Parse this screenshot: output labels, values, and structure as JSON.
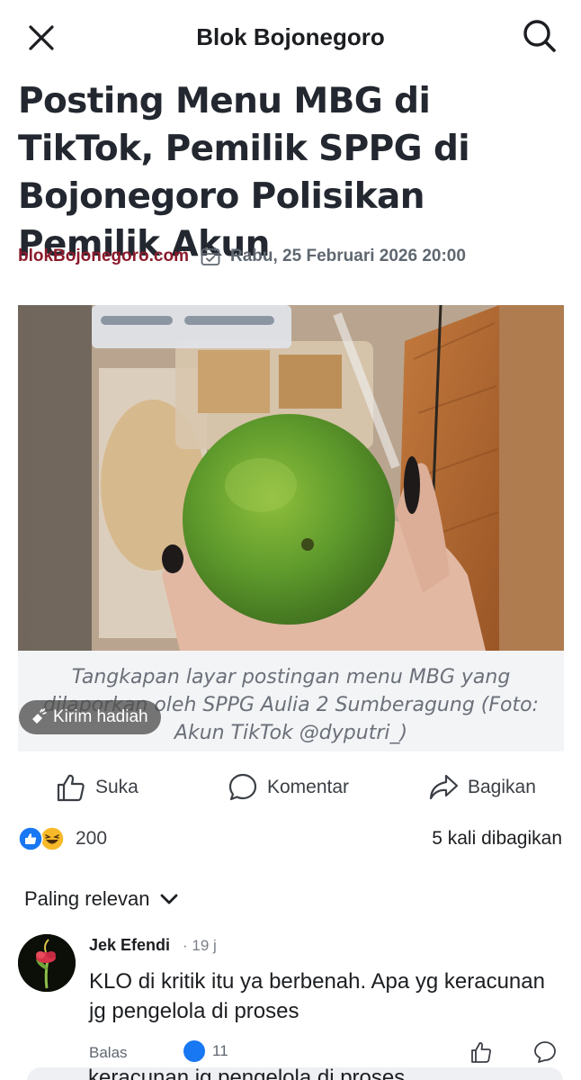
{
  "header": {
    "title": "Blok Bojonegoro",
    "close_icon": "close-icon",
    "search_icon": "search-icon"
  },
  "article": {
    "headline": "Posting Menu MBG di TikTok, Pemilik SPPG di Bojonegoro Polisikan Pemilik Akun",
    "source": "blokBojonegoro.com",
    "date_icon": "calendar-icon",
    "date": "Rabu, 25 Februari 2026 20:00",
    "image_alt": "Tangkapan layar TikTok: tangan memegang jeruk hijau di depan makanan dalam plastik",
    "caption": "Tangkapan layar postingan menu MBG yang dilaporkan oleh SPPG Aulia 2 Sumberagung (Foto: Akun TikTok @dyputri_)"
  },
  "gift_chip": {
    "label": "Kirim hadiah",
    "icon": "gift-icon"
  },
  "actions": {
    "like": "Suka",
    "comment": "Komentar",
    "share": "Bagikan"
  },
  "stats": {
    "reaction_count": "200",
    "shares": "5 kali dibagikan"
  },
  "comments": {
    "sort_label": "Paling relevan",
    "items": [
      {
        "author": "Jek Efendi",
        "time": "· 19 j",
        "text": "KLO di kritik itu ya berbenah. Apa yg keracunan jg pengelola di proses",
        "reply_label": "Balas",
        "like_count": "11"
      }
    ]
  },
  "composer_ghost_text": "keracunan jg pengelola di proses",
  "colors": {
    "source": "#8b1a2b",
    "like_blue": "#1877f2",
    "haha_yellow": "#f7b928"
  }
}
